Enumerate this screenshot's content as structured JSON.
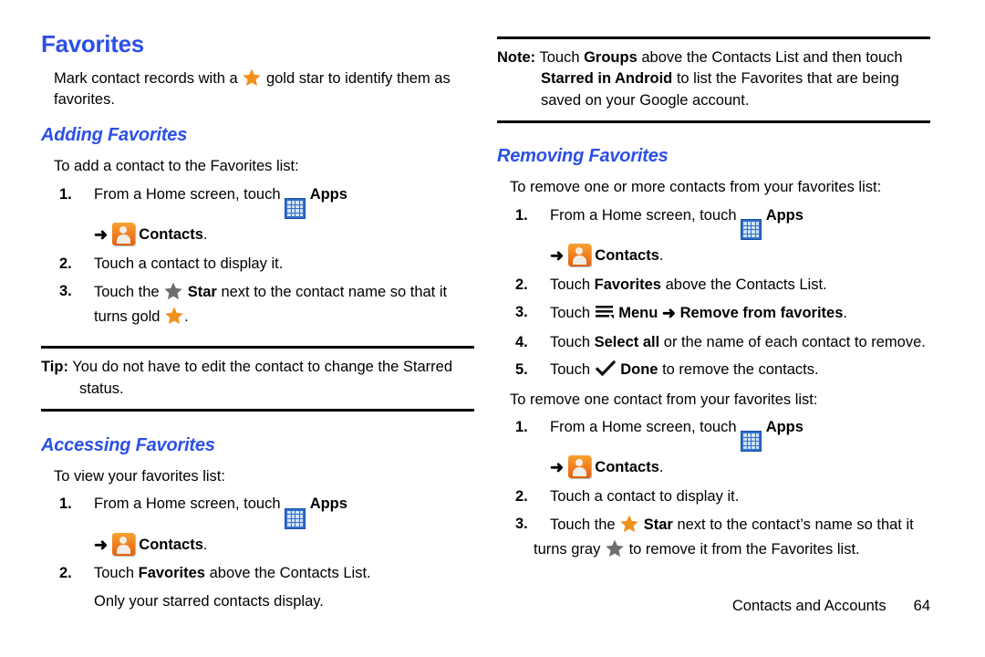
{
  "document": {
    "title": "Favorites",
    "footer": {
      "section": "Contacts and Accounts",
      "page_number": "64"
    }
  },
  "colors": {
    "heading_blue": "#2B50E8",
    "gold_star": "#F2901C",
    "gray_star": "#6E6E6E",
    "apps_icon_blue": "#2F6FD0",
    "contacts_icon_orange": "#F07C1E"
  },
  "icons": {
    "apps": "apps-grid-icon",
    "contacts": "contacts-person-icon",
    "star_gold": "gold-star-icon",
    "star_gray": "gray-star-icon",
    "menu": "menu-icon",
    "check": "check-done-icon",
    "arrow": "➜"
  },
  "left_column": {
    "title": "Favorites",
    "intro": {
      "before_star": "Mark contact records with a",
      "after_star": "gold star to identify them as favorites."
    },
    "adding": {
      "heading": "Adding Favorites",
      "lead": "To add a contact to the Favorites list:",
      "steps": [
        {
          "num": "1.",
          "text_before_icon": "From a Home screen, touch",
          "bold_after_icon": "Apps",
          "sub_bold": "Contacts",
          "sub_suffix": "."
        },
        {
          "num": "2.",
          "text": "Touch a contact to display it."
        },
        {
          "num": "3.",
          "text_before_star": "Touch the",
          "bold_star_label": "Star",
          "text_after_star": "next to the contact name so that it",
          "cont_before_star": "turns gold",
          "cont_after_star": "."
        }
      ]
    },
    "tip": {
      "label": "Tip:",
      "body": "You do not have to edit the contact to change the Starred status."
    },
    "accessing": {
      "heading": "Accessing Favorites",
      "lead": "To view your favorites list:",
      "steps": [
        {
          "num": "1.",
          "text_before_icon": "From a Home screen, touch",
          "bold_after_icon": "Apps",
          "sub_bold": "Contacts",
          "sub_suffix": "."
        },
        {
          "num": "2.",
          "text_before_bold": "Touch",
          "bold": "Favorites",
          "text_after_bold": "above the Contacts List."
        }
      ],
      "trailing": "Only your starred contacts display."
    }
  },
  "right_column": {
    "note": {
      "label": "Note:",
      "part1": "Touch",
      "bold1": "Groups",
      "part2": "above the Contacts List and then touch",
      "bold2": "Starred in Android",
      "part3": "to list the Favorites that are being saved on your Google account."
    },
    "removing": {
      "heading": "Removing Favorites",
      "lead_multi": "To remove one or more contacts from your favorites list:",
      "steps_multi": [
        {
          "num": "1.",
          "text_before_icon": "From a Home screen, touch",
          "bold_after_icon": "Apps",
          "sub_bold": "Contacts",
          "sub_suffix": "."
        },
        {
          "num": "2.",
          "text_before_bold": "Touch",
          "bold": "Favorites",
          "text_after_bold": "above the Contacts List."
        },
        {
          "num": "3.",
          "text_before_icon": "Touch",
          "bold_menu": "Menu",
          "bold_action": "Remove from favorites",
          "suffix": "."
        },
        {
          "num": "4.",
          "text_before_bold": "Touch",
          "bold": "Select all",
          "text_after_bold": "or the name of each contact to remove."
        },
        {
          "num": "5.",
          "text_before_icon": "Touch",
          "bold_after_icon": "Done",
          "text_after_bold": "to remove the contacts."
        }
      ],
      "lead_single": "To remove one contact from your favorites list:",
      "steps_single": [
        {
          "num": "1.",
          "text_before_icon": "From a Home screen, touch",
          "bold_after_icon": "Apps",
          "sub_bold": "Contacts",
          "sub_suffix": "."
        },
        {
          "num": "2.",
          "text": "Touch a contact to display it."
        },
        {
          "num": "3.",
          "text_before_star": "Touch the",
          "bold_star_label": "Star",
          "text_after_star": "next to the contact’s name so that it",
          "cont_before_star": "turns gray",
          "cont_after_star": "to remove it from the Favorites list."
        }
      ]
    }
  }
}
